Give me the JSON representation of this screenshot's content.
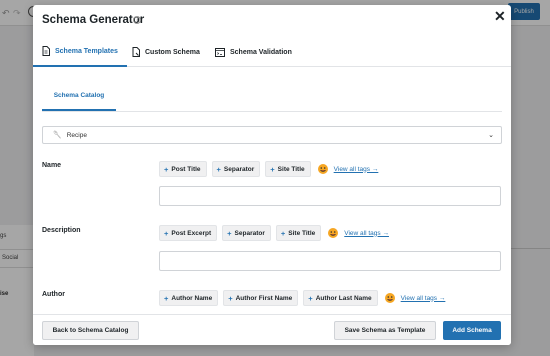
{
  "background": {
    "publish_label": "Publish",
    "panel_text_1": "gs",
    "panel_text_2": "Social",
    "panel_text_3": "ise"
  },
  "modal": {
    "title": "Schema Generator",
    "help_glyph": "?",
    "close_glyph": "✕"
  },
  "tabs": [
    {
      "label": "Schema Templates",
      "icon": "document-icon",
      "active": true
    },
    {
      "label": "Custom Schema",
      "icon": "custom-schema-icon",
      "active": false
    },
    {
      "label": "Schema Validation",
      "icon": "validation-icon",
      "active": false
    }
  ],
  "subtab": {
    "label": "Schema Catalog"
  },
  "schema_select": {
    "icon": "recipe-icon",
    "value": "Recipe",
    "chevron": "⌄"
  },
  "fields": [
    {
      "label": "Name",
      "tags": [
        "Post Title",
        "Separator",
        "Site Title"
      ],
      "view_all": "View all tags →"
    },
    {
      "label": "Description",
      "tags": [
        "Post Excerpt",
        "Separator",
        "Site Title"
      ],
      "view_all": "View all tags →"
    },
    {
      "label": "Author",
      "tags": [
        "Author Name",
        "Author First Name",
        "Author Last Name"
      ],
      "view_all": "View all tags →"
    }
  ],
  "footer": {
    "back_label": "Back to Schema Catalog",
    "save_template_label": "Save Schema as Template",
    "add_label": "Add Schema"
  },
  "colors": {
    "accent": "#2271b1"
  }
}
